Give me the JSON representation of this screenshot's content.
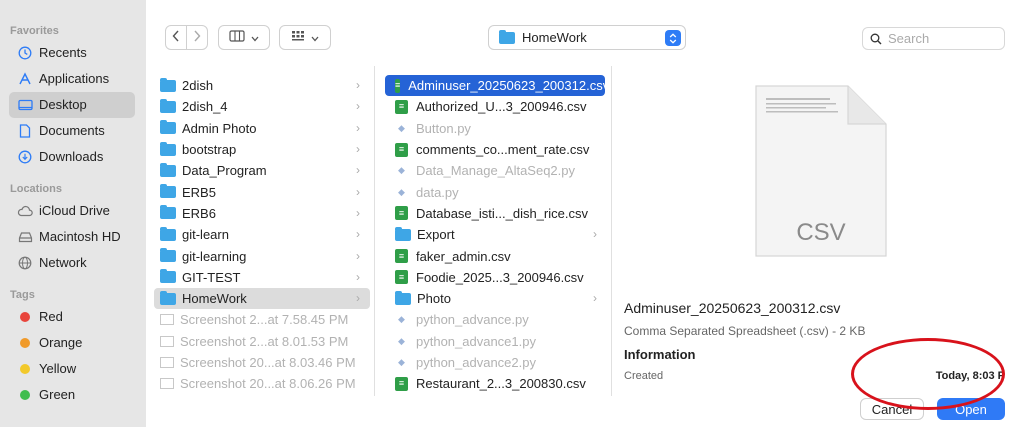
{
  "sidebar": {
    "favorites_label": "Favorites",
    "favorites": [
      {
        "label": "Recents",
        "icon": "clock-icon"
      },
      {
        "label": "Applications",
        "icon": "applications-icon"
      },
      {
        "label": "Desktop",
        "icon": "desktop-icon"
      },
      {
        "label": "Documents",
        "icon": "document-icon"
      },
      {
        "label": "Downloads",
        "icon": "download-icon"
      }
    ],
    "locations_label": "Locations",
    "locations": [
      {
        "label": "iCloud Drive",
        "icon": "cloud-icon"
      },
      {
        "label": "Macintosh HD",
        "icon": "disk-icon"
      },
      {
        "label": "Network",
        "icon": "network-icon"
      }
    ],
    "tags_label": "Tags",
    "tags": [
      {
        "label": "Red",
        "color": "#e8453c"
      },
      {
        "label": "Orange",
        "color": "#f09a2a"
      },
      {
        "label": "Yellow",
        "color": "#f2c92b"
      },
      {
        "label": "Green",
        "color": "#3fbd4e"
      }
    ]
  },
  "toolbar": {
    "location": "HomeWork",
    "search_placeholder": "Search"
  },
  "column1": [
    {
      "label": "2dish",
      "type": "folder"
    },
    {
      "label": "2dish_4",
      "type": "folder"
    },
    {
      "label": "Admin Photo",
      "type": "folder"
    },
    {
      "label": "bootstrap",
      "type": "folder"
    },
    {
      "label": "Data_Program",
      "type": "folder"
    },
    {
      "label": "ERB5",
      "type": "folder"
    },
    {
      "label": "ERB6",
      "type": "folder"
    },
    {
      "label": "git-learn",
      "type": "folder"
    },
    {
      "label": "git-learning",
      "type": "folder"
    },
    {
      "label": "GIT-TEST",
      "type": "folder"
    },
    {
      "label": "HomeWork",
      "type": "folder"
    },
    {
      "label": "Screenshot 2...at 7.58.45 PM",
      "type": "image"
    },
    {
      "label": "Screenshot 2...at 8.01.53 PM",
      "type": "image"
    },
    {
      "label": "Screenshot 20...at 8.03.46 PM",
      "type": "image"
    },
    {
      "label": "Screenshot 20...at 8.06.26 PM",
      "type": "image"
    }
  ],
  "column2": [
    {
      "label": "Adminuser_20250623_200312.csv",
      "type": "csv"
    },
    {
      "label": "Authorized_U...3_200946.csv",
      "type": "csv"
    },
    {
      "label": "Button.py",
      "type": "py"
    },
    {
      "label": "comments_co...ment_rate.csv",
      "type": "csv"
    },
    {
      "label": "Data_Manage_AltaSeq2.py",
      "type": "py"
    },
    {
      "label": "data.py",
      "type": "py"
    },
    {
      "label": "Database_isti..._dish_rice.csv",
      "type": "csv"
    },
    {
      "label": "Export",
      "type": "folder"
    },
    {
      "label": "faker_admin.csv",
      "type": "csv"
    },
    {
      "label": "Foodie_2025...3_200946.csv",
      "type": "csv"
    },
    {
      "label": "Photo",
      "type": "folder"
    },
    {
      "label": "python_advance.py",
      "type": "py"
    },
    {
      "label": "python_advance1.py",
      "type": "py"
    },
    {
      "label": "python_advance2.py",
      "type": "py"
    },
    {
      "label": "Restaurant_2...3_200830.csv",
      "type": "csv"
    }
  ],
  "preview": {
    "doc_label": "CSV",
    "file_name": "Adminuser_20250623_200312.csv",
    "kind": "Comma Separated Spreadsheet (.csv) - 2 KB",
    "info_heading": "Information",
    "created_label": "Created",
    "created_value": "Today, 8:03 P"
  },
  "buttons": {
    "cancel": "Cancel",
    "open": "Open"
  },
  "colors": {
    "accent": "#2f7af6",
    "selection_blue": "#2563d6",
    "annotation_red": "#d8121b"
  }
}
